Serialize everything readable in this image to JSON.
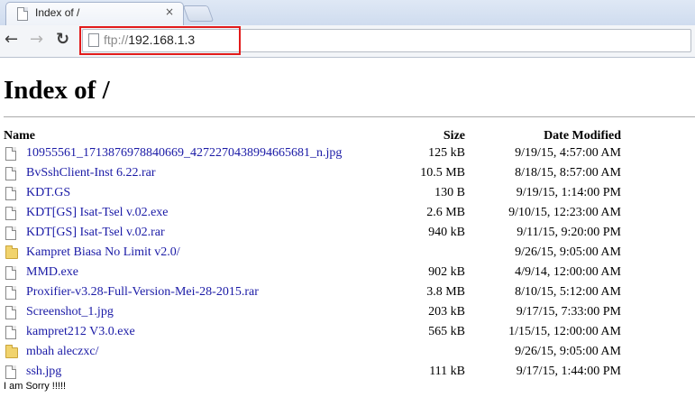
{
  "browser": {
    "tab_title": "Index of /",
    "tab_close": "×",
    "nav": {
      "back": "←",
      "forward": "→",
      "reload": "↻"
    },
    "address": {
      "scheme": "ftp://",
      "host": "192.168.1.3"
    },
    "highlight_color": "#e21b1b"
  },
  "page": {
    "title": "Index of /",
    "headers": {
      "name": "Name",
      "size": "Size",
      "date": "Date Modified"
    },
    "entries": [
      {
        "type": "file",
        "name": "10955561_1713876978840669_4272270438994665681_n.jpg",
        "size": "125 kB",
        "date": "9/19/15, 4:57:00 AM"
      },
      {
        "type": "file",
        "name": "BvSshClient-Inst 6.22.rar",
        "size": "10.5 MB",
        "date": "8/18/15, 8:57:00 AM"
      },
      {
        "type": "file",
        "name": "KDT.GS",
        "size": "130 B",
        "date": "9/19/15, 1:14:00 PM"
      },
      {
        "type": "file",
        "name": "KDT[GS] Isat-Tsel v.02.exe",
        "size": "2.6 MB",
        "date": "9/10/15, 12:23:00 AM"
      },
      {
        "type": "file",
        "name": "KDT[GS] Isat-Tsel v.02.rar",
        "size": "940 kB",
        "date": "9/11/15, 9:20:00 PM"
      },
      {
        "type": "folder",
        "name": "Kampret Biasa No Limit v2.0/",
        "size": "",
        "date": "9/26/15, 9:05:00 AM"
      },
      {
        "type": "file",
        "name": "MMD.exe",
        "size": "902 kB",
        "date": "4/9/14, 12:00:00 AM"
      },
      {
        "type": "file",
        "name": "Proxifier-v3.28-Full-Version-Mei-28-2015.rar",
        "size": "3.8 MB",
        "date": "8/10/15, 5:12:00 AM"
      },
      {
        "type": "file",
        "name": "Screenshot_1.jpg",
        "size": "203 kB",
        "date": "9/17/15, 7:33:00 PM"
      },
      {
        "type": "file",
        "name": "kampret212 V3.0.exe",
        "size": "565 kB",
        "date": "1/15/15, 12:00:00 AM"
      },
      {
        "type": "folder",
        "name": "mbah aleczxc/",
        "size": "",
        "date": "9/26/15, 9:05:00 AM"
      },
      {
        "type": "file",
        "name": "ssh.jpg",
        "size": "111 kB",
        "date": "9/17/15, 1:44:00 PM"
      }
    ],
    "footer": "I am Sorry !!!!!"
  }
}
